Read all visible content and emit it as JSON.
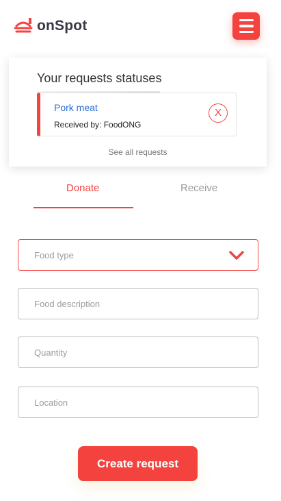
{
  "app": {
    "name": "onSpot"
  },
  "colors": {
    "accent": "#f4423f",
    "link": "#2a6fd6"
  },
  "header": {
    "menu_icon": "hamburger-menu-icon",
    "logo_icon": "food-tray-icon"
  },
  "requests_panel": {
    "title": "Your requests statuses",
    "items": [
      {
        "name": "Pork meat",
        "status": "Received by: FoodONG",
        "close_label": "X"
      }
    ],
    "see_all": "See all requests"
  },
  "tabs": [
    {
      "label": "Donate",
      "active": true
    },
    {
      "label": "Receive",
      "active": false
    }
  ],
  "form": {
    "food_type": {
      "placeholder": "Food type",
      "icon": "chevron-down-icon"
    },
    "food_description": {
      "placeholder": "Food description"
    },
    "quantity": {
      "placeholder": "Quantity"
    },
    "location": {
      "placeholder": "Location"
    },
    "submit_label": "Create request"
  }
}
